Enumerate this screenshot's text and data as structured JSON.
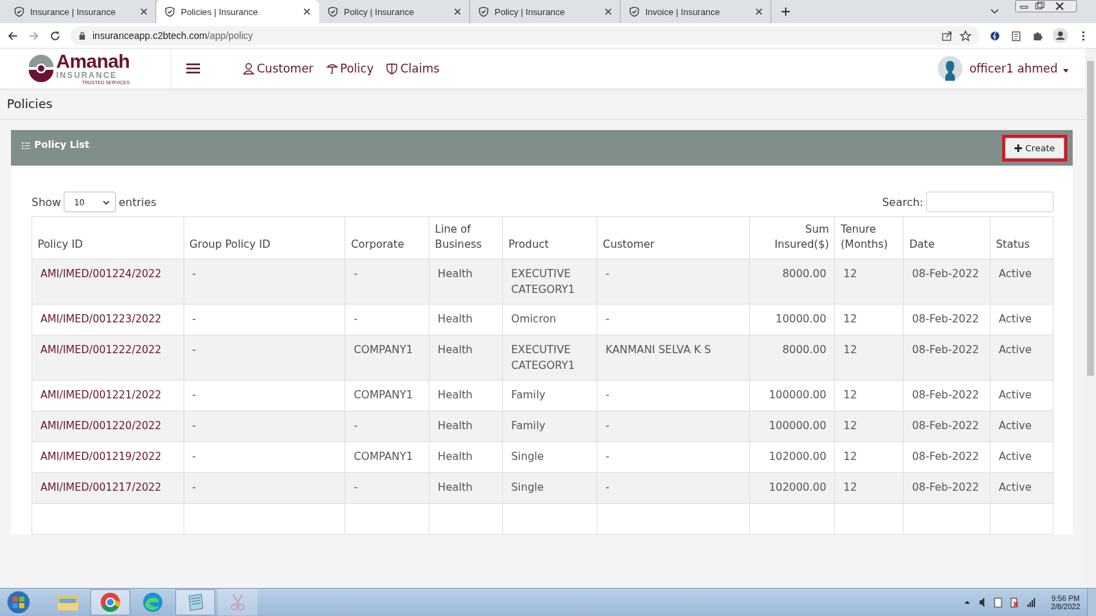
{
  "browser": {
    "tabs": [
      {
        "title": "Insurance | Insurance",
        "selected": false
      },
      {
        "title": "Policies | Insurance",
        "selected": true
      },
      {
        "title": "Policy | Insurance",
        "selected": false
      },
      {
        "title": "Policy | Insurance",
        "selected": false
      },
      {
        "title": "Invoice | Insurance",
        "selected": false
      }
    ],
    "address": {
      "host": "insuranceapp.c2btech.com",
      "path": "/app/policy"
    }
  },
  "header": {
    "logo": {
      "name": "Amanah",
      "sub": "INSURANCE",
      "tagline": "TRUSTED SERVICES"
    },
    "nav": [
      "Customer",
      "Policy",
      "Claims"
    ],
    "user": "officer1 ahmed"
  },
  "page_title": "Policies",
  "panel": {
    "title": "Policy List",
    "create_button": "Create"
  },
  "length": {
    "show": "Show",
    "value": "10",
    "entries": "entries"
  },
  "search": {
    "label": "Search:"
  },
  "table": {
    "columns": [
      {
        "label": "Policy ID",
        "kind": "text"
      },
      {
        "label": "Group Policy ID",
        "kind": "text"
      },
      {
        "label": "Corporate",
        "kind": "text"
      },
      {
        "label": "Line of Business",
        "kind": "text"
      },
      {
        "label": "Product",
        "kind": "text"
      },
      {
        "label": "Customer",
        "kind": "text"
      },
      {
        "label": "Sum Insured($)",
        "kind": "amount"
      },
      {
        "label": "Tenure (Months)",
        "kind": "text"
      },
      {
        "label": "Date",
        "kind": "text"
      },
      {
        "label": "Status",
        "kind": "text"
      }
    ],
    "rows": [
      [
        "AMI/IMED/001224/2022",
        "-",
        "-",
        "Health",
        "EXECUTIVE CATEGORY1",
        "-",
        "8000.00",
        "12",
        "08-Feb-2022",
        "Active"
      ],
      [
        "AMI/IMED/001223/2022",
        "-",
        "-",
        "Health",
        "Omicron",
        "-",
        "10000.00",
        "12",
        "08-Feb-2022",
        "Active"
      ],
      [
        "AMI/IMED/001222/2022",
        "-",
        "COMPANY1",
        "Health",
        "EXECUTIVE CATEGORY1",
        "KANMANI SELVA K S",
        "8000.00",
        "12",
        "08-Feb-2022",
        "Active"
      ],
      [
        "AMI/IMED/001221/2022",
        "-",
        "COMPANY1",
        "Health",
        "Family",
        "-",
        "100000.00",
        "12",
        "08-Feb-2022",
        "Active"
      ],
      [
        "AMI/IMED/001220/2022",
        "-",
        "-",
        "Health",
        "Family",
        "-",
        "100000.00",
        "12",
        "08-Feb-2022",
        "Active"
      ],
      [
        "AMI/IMED/001219/2022",
        "-",
        "COMPANY1",
        "Health",
        "Single",
        "-",
        "102000.00",
        "12",
        "08-Feb-2022",
        "Active"
      ],
      [
        "AMI/IMED/001217/2022",
        "-",
        "-",
        "Health",
        "Single",
        "-",
        "102000.00",
        "12",
        "08-Feb-2022",
        "Active"
      ]
    ]
  },
  "taskbar": {
    "time": "9:56 PM",
    "date": "2/8/2022"
  }
}
